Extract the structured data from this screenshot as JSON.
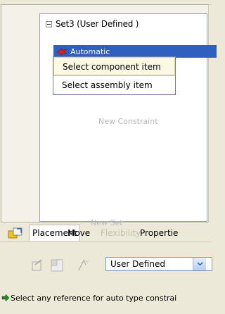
{
  "tree": {
    "set_label": "Set3 (User Defined )",
    "constraint_label": "Automatic",
    "new_constraint": "New Constraint",
    "new_set": "New Set"
  },
  "context_menu": {
    "items": [
      {
        "label": "Select component item"
      },
      {
        "label": "Select assembly item"
      }
    ]
  },
  "tabs": {
    "placement": "Placement",
    "move": "Move",
    "flexibility": "Flexibility",
    "properties": "Propertie"
  },
  "toolbar": {
    "combo_value": "User Defined"
  },
  "status": {
    "message": "Select any reference for auto type constrai"
  },
  "colors": {
    "selection": "#2f5fbf",
    "disabled_text": "#b7b7b7",
    "menu_hover": "#fbf8e4",
    "status_icon": "#1d8a1d",
    "constraint_icon": "#e0201c"
  },
  "icons": {
    "tree_toggle": "minus-box-icon",
    "constraint": "red-arrow-icon",
    "placement_tab": "placement-icon",
    "status": "green-arrow-icon"
  }
}
